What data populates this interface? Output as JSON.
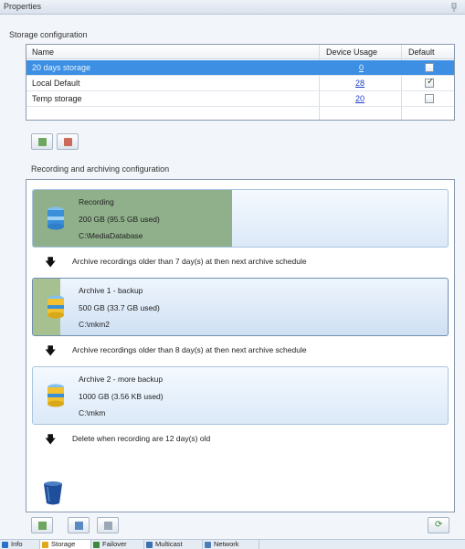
{
  "window": {
    "title": "Properties"
  },
  "storage": {
    "group_label": "Storage configuration",
    "columns": {
      "name": "Name",
      "usage": "Device Usage",
      "default": "Default"
    },
    "rows": [
      {
        "name": "20 days storage",
        "usage": "0",
        "default": false,
        "selected": true
      },
      {
        "name": "Local Default",
        "usage": "28",
        "default": true,
        "selected": false
      },
      {
        "name": "Temp storage",
        "usage": "20",
        "default": false,
        "selected": false
      }
    ],
    "buttons": {
      "add_icon": "add-storage-icon",
      "remove_icon": "remove-storage-icon"
    }
  },
  "recording": {
    "group_label": "Recording and archiving configuration",
    "cards": [
      {
        "title": "Recording",
        "size": "200 GB (95.5 GB used)",
        "path": "C:\\MediaDatabase",
        "used_fraction": 0.48,
        "fill_color": "#8fb08a"
      },
      {
        "title": "Archive 1 - backup",
        "size": "500 GB (33.7 GB used)",
        "path": "C:\\mkm2",
        "used_fraction": 0.067,
        "fill_color": "#a7c08f"
      },
      {
        "title": "Archive 2 - more backup",
        "size": "1000 GB (3.56 KB used)",
        "path": "C:\\mkm",
        "used_fraction": 0.0,
        "fill_color": "#a7c08f"
      }
    ],
    "rules": [
      "Archive recordings older than 7 day(s) at then next archive schedule",
      "Archive recordings older than 8 day(s) at then next archive schedule",
      "Delete when recording are 12 day(s) old"
    ]
  },
  "tabs": [
    {
      "label": "Info",
      "icon": "info-icon",
      "color": "#2a6fc9"
    },
    {
      "label": "Storage",
      "icon": "storage-icon",
      "color": "#e0a81c"
    },
    {
      "label": "Failover",
      "icon": "failover-icon",
      "color": "#3a8a3a"
    },
    {
      "label": "Multicast",
      "icon": "multicast-icon",
      "color": "#3a6fb0"
    },
    {
      "label": "Network",
      "icon": "network-icon",
      "color": "#4a7fb8"
    }
  ],
  "colors": {
    "selection": "#3d8fe3",
    "link": "#2040c8",
    "db_yellow": "#f2c230",
    "db_blue": "#3a8fd8"
  }
}
